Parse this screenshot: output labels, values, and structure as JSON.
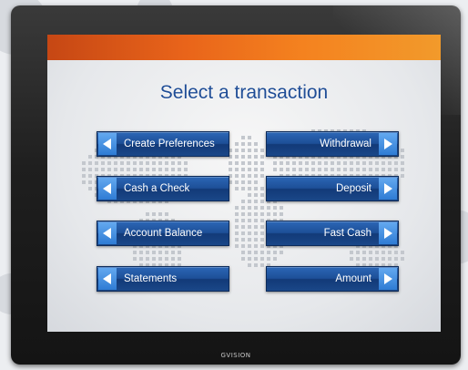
{
  "screen": {
    "title": "Select a transaction",
    "accent_color": "#f4821f",
    "button_color": "#1d4f97",
    "left_buttons": [
      {
        "label": "Create Preferences",
        "icon": "arrow-left-icon"
      },
      {
        "label": "Cash a Check",
        "icon": "arrow-left-icon"
      },
      {
        "label": "Account Balance",
        "icon": "arrow-left-icon"
      },
      {
        "label": "Statements",
        "icon": "arrow-left-icon"
      }
    ],
    "right_buttons": [
      {
        "label": "Withdrawal",
        "icon": "arrow-right-icon"
      },
      {
        "label": "Deposit",
        "icon": "arrow-right-icon"
      },
      {
        "label": "Fast Cash",
        "icon": "arrow-right-icon"
      },
      {
        "label": "Amount",
        "icon": "arrow-right-icon"
      }
    ]
  },
  "monitor": {
    "brand": "GVISION"
  }
}
